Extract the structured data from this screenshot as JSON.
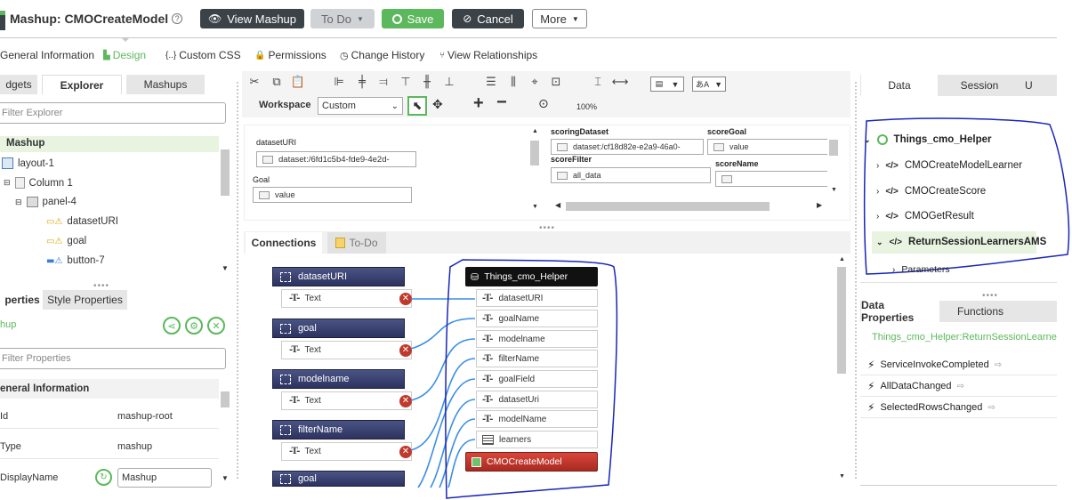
{
  "header": {
    "title": "Mashup: CMOCreateModel",
    "help_glyph": "?",
    "view_mashup": "View Mashup",
    "todo": "To Do",
    "save": "Save",
    "cancel": "Cancel",
    "more": "More"
  },
  "nav_tabs": [
    "General Information",
    "Design",
    "Custom CSS",
    "Permissions",
    "Change History",
    "View Relationships"
  ],
  "left_tabs": [
    "dgets",
    "Explorer",
    "Mashups"
  ],
  "filter_explorer_placeholder": "Filter Explorer",
  "explorer_tree": {
    "root": "Mashup",
    "items": [
      "layout-1",
      "Column 1",
      "panel-4",
      "datasetURI",
      "goal",
      "button-7"
    ]
  },
  "props": {
    "tabs": [
      "perties",
      "Style Properties"
    ],
    "selected": "hup",
    "filter_placeholder": "Filter Properties",
    "section": "eneral Information",
    "rows": [
      {
        "key": "Id",
        "value": "mashup-root"
      },
      {
        "key": "Type",
        "value": "mashup"
      },
      {
        "key": "DisplayName",
        "value": "Mashup"
      }
    ]
  },
  "workspace": {
    "label": "Workspace",
    "mode": "Custom",
    "zoom": "100%"
  },
  "canvas": {
    "datasetURI_label": "datasetURI",
    "datasetURI_value": "dataset:/6fd1c5b4-fde9-4e2d-",
    "goal_label": "Goal",
    "goal_value": "value",
    "scoringDataset_label": "scoringDataset",
    "scoringDataset_value": "dataset:/cf18d82e-e2a9-46a0-",
    "scoreGoal_label": "scoreGoal",
    "scoreGoal_value": "value",
    "scoreFilter_label": "scoreFilter",
    "scoreFilter_value": "all_data",
    "scoreName_label": "scoreName"
  },
  "connections": {
    "tabs": [
      "Connections",
      "To-Do"
    ],
    "sources": [
      {
        "name": "datasetURI",
        "sub": "Text"
      },
      {
        "name": "goal",
        "sub": "Text"
      },
      {
        "name": "modelname",
        "sub": "Text"
      },
      {
        "name": "filterName",
        "sub": "Text"
      },
      {
        "name": "goal",
        "sub": ""
      }
    ],
    "target_title": "Things_cmo_Helper",
    "target_params": [
      "datasetURI",
      "goalName",
      "modelname",
      "filterName",
      "goalField",
      "datasetUri",
      "modelName",
      "learners"
    ],
    "target_service": "CMOCreateModel",
    "remove_glyph": "✕"
  },
  "right": {
    "tabs": [
      "Data",
      "Session",
      "U"
    ],
    "tree_root": "Things_cmo_Helper",
    "services": [
      "CMOCreateModelLearner",
      "CMOCreateScore",
      "CMOGetResult",
      "ReturnSessionLearnersAMS"
    ],
    "params_label": "Parameters",
    "props_tabs": [
      "Data Properties",
      "Functions"
    ],
    "selected_path": "Things_cmo_Helper:ReturnSessionLearner",
    "events": [
      "ServiceInvokeCompleted",
      "AllDataChanged",
      "SelectedRowsChanged"
    ]
  },
  "colors": {
    "accent_green": "#5cb85c",
    "dark_button": "#3b4248",
    "service_red": "#c0392b",
    "annotation_blue": "#1a25b8",
    "link_blue": "#3a8ee6"
  }
}
